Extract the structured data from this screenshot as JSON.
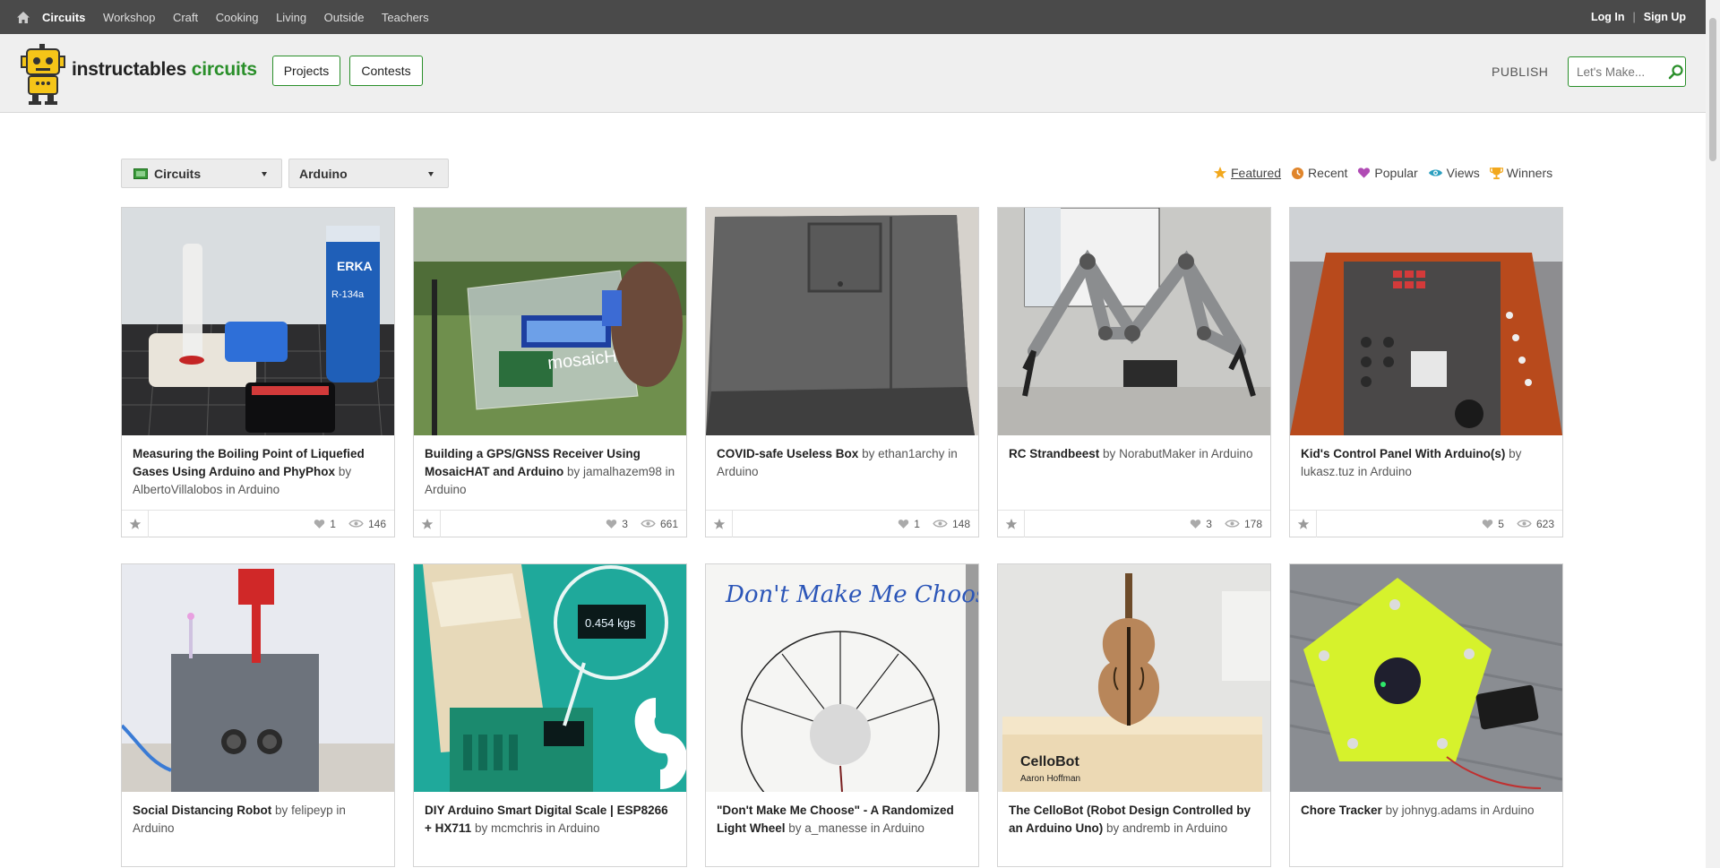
{
  "topbar": {
    "nav": [
      "Circuits",
      "Workshop",
      "Craft",
      "Cooking",
      "Living",
      "Outside",
      "Teachers"
    ],
    "login": "Log In",
    "separator": "|",
    "signup": "Sign Up"
  },
  "header": {
    "brand_main": "instructables",
    "brand_sub": "circuits",
    "projects_button": "Projects",
    "contests_button": "Contests",
    "publish": "PUBLISH",
    "search_placeholder": "Let's Make..."
  },
  "filters": {
    "category": "Circuits",
    "channel": "Arduino"
  },
  "sorts": [
    "Featured",
    "Recent",
    "Popular",
    "Views",
    "Winners"
  ],
  "colors": {
    "accent": "#2a8f2a",
    "topbar": "#4a4a4a",
    "header": "#efefef"
  },
  "cards": [
    {
      "title": "Measuring the Boiling Point of Liquefied Gases Using Arduino and PhyPhox",
      "by": "by",
      "author": "AlbertoVillalobos",
      "in": "in",
      "channel": "Arduino",
      "favorites": "1",
      "views": "146"
    },
    {
      "title": "Building a GPS/GNSS Receiver Using MosaicHAT and Arduino",
      "by": "by",
      "author": "jamalhazem98",
      "in": "in",
      "channel": "Arduino",
      "favorites": "3",
      "views": "661"
    },
    {
      "title": "COVID-safe Useless Box",
      "by": "by",
      "author": "ethan1archy",
      "in": "in",
      "channel": "Arduino",
      "favorites": "1",
      "views": "148"
    },
    {
      "title": "RC Strandbeest",
      "by": "by",
      "author": "NorabutMaker",
      "in": "in",
      "channel": "Arduino",
      "favorites": "3",
      "views": "178"
    },
    {
      "title": "Kid's Control Panel With Arduino(s)",
      "by": "by",
      "author": "lukasz.tuz",
      "in": "in",
      "channel": "Arduino",
      "favorites": "5",
      "views": "623"
    },
    {
      "title": "Social Distancing Robot",
      "by": "by",
      "author": "felipeyp",
      "in": "in",
      "channel": "Arduino"
    },
    {
      "title": "DIY Arduino Smart Digital Scale | ESP8266 + HX711",
      "by": "by",
      "author": "mcmchris",
      "in": "in",
      "channel": "Arduino"
    },
    {
      "title": "\"Don't Make Me Choose\" - A Randomized Light Wheel",
      "by": "by",
      "author": "a_manesse",
      "in": "in",
      "channel": "Arduino"
    },
    {
      "title": "The CelloBot (Robot Design Controlled by an Arduino Uno)",
      "by": "by",
      "author": "andremb",
      "in": "in",
      "channel": "Arduino"
    },
    {
      "title": "Chore Tracker",
      "by": "by",
      "author": "johnyg.adams",
      "in": "in",
      "channel": "Arduino"
    }
  ],
  "image_text": {
    "can_brand": "ERKA",
    "can_label": "R-134a",
    "pcb_label": "mosaicHAT",
    "scale_reading": "0.454 kgs",
    "board_title": "Don't Make Me Choose!",
    "cello_label": "CelloBot",
    "cello_names": "Aaron Hoffman"
  }
}
